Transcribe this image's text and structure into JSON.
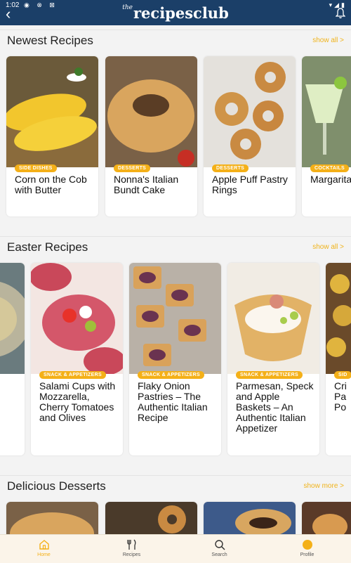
{
  "status": {
    "time": "1:02",
    "left_icons": "◉ ⊗ ⊠",
    "right_icons": "▾◢▮"
  },
  "header": {
    "logo_small": "the",
    "logo": "recipesclub"
  },
  "sections": [
    {
      "title": "Newest Recipes",
      "link": "show all >",
      "cards": [
        {
          "badge": "SIDE DISHES",
          "title": "Corn on the Cob with Butter"
        },
        {
          "badge": "DESSERTS",
          "title": "Nonna's Italian Bundt Cake"
        },
        {
          "badge": "DESSERTS",
          "title": "Apple Puff Pastry Rings"
        },
        {
          "badge": "COCKTAILS",
          "title": "Margarita Original"
        }
      ]
    },
    {
      "title": "Easter Recipes",
      "link": "show all >",
      "cards": [
        {
          "badge": "",
          "title": ""
        },
        {
          "badge": "SNACK & APPETIZERS",
          "title": "Salami Cups with Mozzarella, Cherry Tomatoes and Olives"
        },
        {
          "badge": "SNACK & APPETIZERS",
          "title": "Flaky Onion Pastries – The Authentic Italian Recipe"
        },
        {
          "badge": "SNACK & APPETIZERS",
          "title": "Parmesan, Speck and Apple Baskets – An Authentic Italian Appetizer"
        },
        {
          "badge": "SID",
          "title": "Cri Pa Po"
        }
      ]
    },
    {
      "title": "Delicious Desserts",
      "link": "show more >"
    }
  ],
  "tabs": [
    {
      "label": "Home",
      "icon": "home-icon",
      "active": true
    },
    {
      "label": "Recipes",
      "icon": "fork-knife-icon",
      "active": false
    },
    {
      "label": "Search",
      "icon": "search-icon",
      "active": false
    },
    {
      "label": "Profile",
      "icon": "profile-dot-icon",
      "active": false
    }
  ],
  "colors": {
    "header": "#1b3f68",
    "accent": "#f4b018",
    "tabbar": "#fbf4e9"
  }
}
